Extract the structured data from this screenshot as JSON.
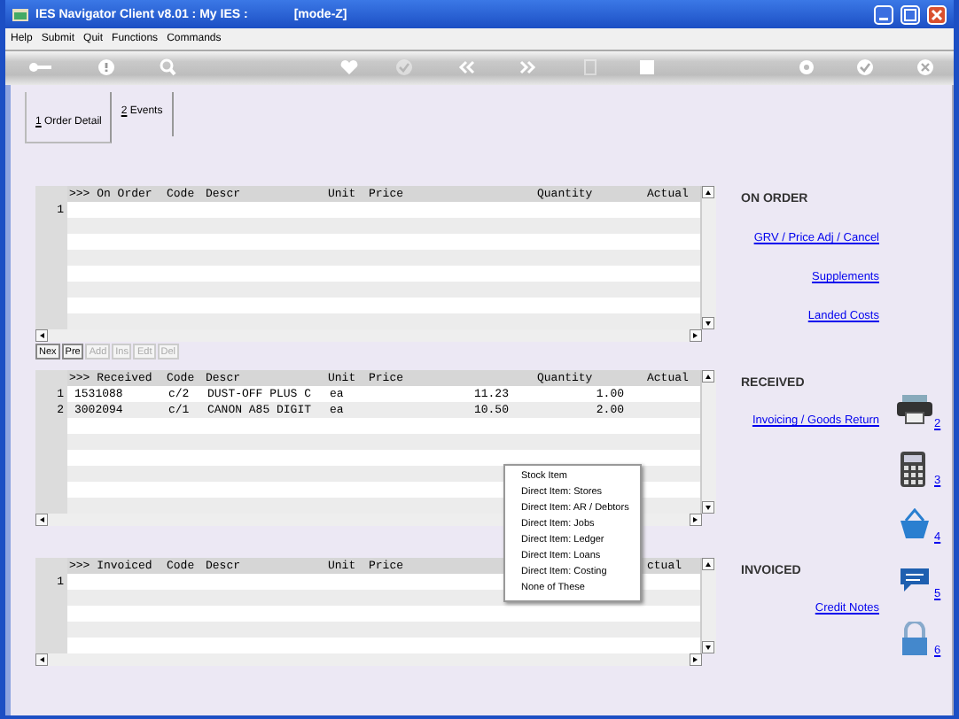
{
  "window": {
    "title": "IES Navigator Client v8.01 : My IES :",
    "mode": "[mode-Z]"
  },
  "menu": [
    "Help",
    "Submit",
    "Quit",
    "Functions",
    "Commands"
  ],
  "toolbar": [
    {
      "kind": "key",
      "disabled": false
    },
    {
      "kind": "help",
      "disabled": false
    },
    {
      "kind": "search",
      "disabled": false
    },
    {
      "kind": "heart",
      "disabled": false
    },
    {
      "kind": "check",
      "disabled": true
    },
    {
      "kind": "back",
      "disabled": false
    },
    {
      "kind": "forward",
      "disabled": false
    },
    {
      "kind": "page",
      "disabled": true
    },
    {
      "kind": "square",
      "disabled": false
    },
    {
      "kind": "gear",
      "disabled": false
    },
    {
      "kind": "check",
      "disabled": false
    },
    {
      "kind": "close",
      "disabled": false
    }
  ],
  "tabs": [
    {
      "label": "1 Order Detail",
      "selected": true
    },
    {
      "label": "2 Events",
      "selected": false
    }
  ],
  "grids": [
    {
      "columns": [
        ">>> On Order",
        "Code",
        "Descr",
        "Unit",
        "Price",
        "Quantity",
        "Actual"
      ],
      "rows": [
        {
          "number": "1"
        }
      ],
      "nav_buttons": [
        {
          "label": "Nex",
          "disabled": false
        },
        {
          "label": "Pre",
          "disabled": false
        },
        {
          "label": "Add",
          "disabled": true
        },
        {
          "label": "Ins",
          "disabled": true
        },
        {
          "label": "Edt",
          "disabled": true
        },
        {
          "label": "Del",
          "disabled": true
        }
      ]
    },
    {
      "columns": [
        ">>> Received",
        "Code",
        "Descr",
        "Unit",
        "Price",
        "Quantity",
        "Actual"
      ],
      "rows": [
        {
          "number": "1",
          "cells": [
            "1531088",
            "c/2",
            "DUST-OFF PLUS C",
            "ea",
            "11.23",
            "1.00"
          ]
        },
        {
          "number": "2",
          "cells": [
            "3002094",
            "c/1",
            "CANON A85 DIGIT",
            "ea",
            "10.50",
            "2.00"
          ]
        }
      ]
    },
    {
      "columns": [
        ">>> Invoiced",
        "Code",
        "Descr",
        "Unit",
        "Price",
        null,
        "ctual"
      ],
      "rows": [
        {
          "number": "1"
        }
      ]
    }
  ],
  "sections": [
    {
      "title": "ON ORDER",
      "links": [
        "GRV / Price Adj / Cancel",
        "Supplements",
        "Landed Costs"
      ]
    },
    {
      "title": "RECEIVED",
      "links": [
        "Invoicing / Goods Return"
      ]
    },
    {
      "title": "INVOICED",
      "links": [
        "Credit Notes"
      ]
    }
  ],
  "side_icons": [
    {
      "kind": "printer",
      "number": "2"
    },
    {
      "kind": "calculator",
      "number": "3"
    },
    {
      "kind": "basket",
      "number": "4"
    },
    {
      "kind": "chat",
      "number": "5"
    },
    {
      "kind": "lock",
      "number": "6"
    }
  ],
  "context_menu": [
    "Stock Item",
    "Direct Item: Stores",
    "Direct Item: AR / Debtors",
    "Direct Item: Jobs",
    "Direct Item: Ledger",
    "Direct Item: Loans",
    "Direct Item: Costing",
    "None of These"
  ]
}
